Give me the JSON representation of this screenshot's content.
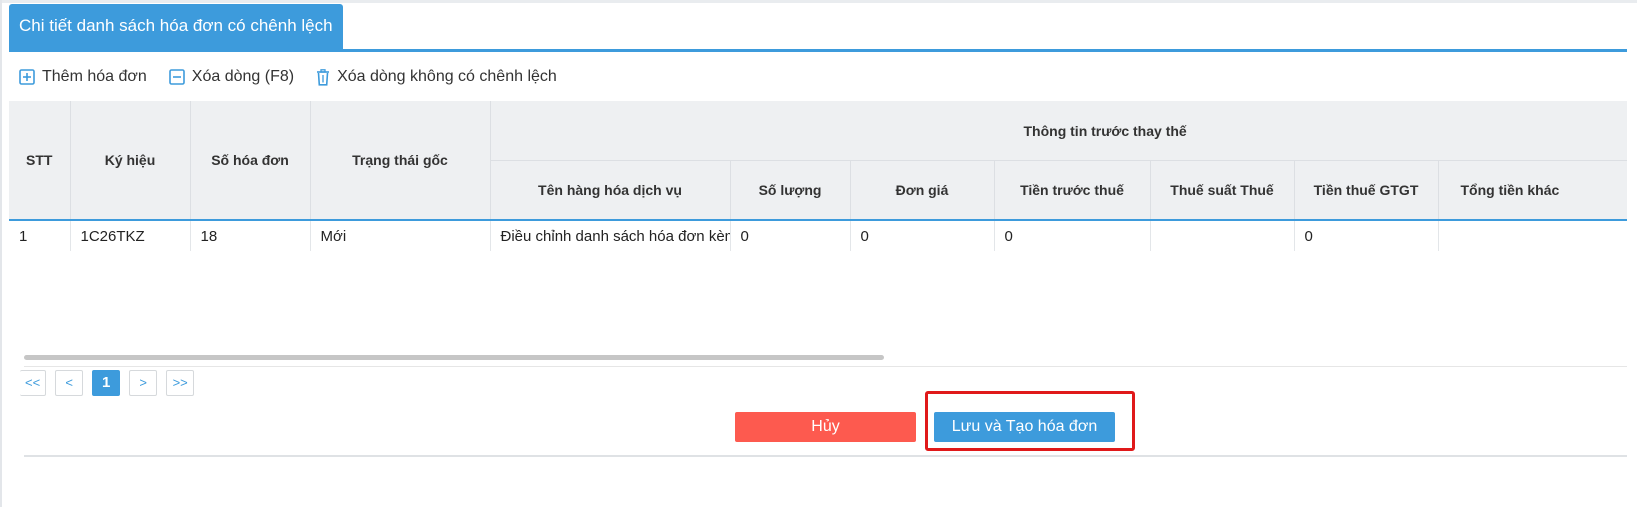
{
  "tab": {
    "title": "Chi tiết danh sách hóa đơn có chênh lệch"
  },
  "toolbar": {
    "add_label": "Thêm hóa đơn",
    "delete_label": "Xóa dòng (F8)",
    "delete_no_diff_label": "Xóa dòng không có chênh lệch"
  },
  "table": {
    "headers": {
      "stt": "STT",
      "ky_hieu": "Ký hiệu",
      "so_hoa_don": "Số hóa đơn",
      "trang_thai_goc": "Trạng thái gốc",
      "group_before": "Thông tin trước thay thế",
      "ten_hang": "Tên hàng hóa dịch vụ",
      "so_luong": "Số lượng",
      "don_gia": "Đơn giá",
      "tien_truoc_thue": "Tiền trước thuế",
      "thue_suat": "Thuế suất Thuế",
      "tien_thue": "Tiền thuế GTGT",
      "tong_tien_khac": "Tổng tiền khác"
    },
    "rows": [
      {
        "stt": "1",
        "ky_hieu": "1C26TKZ",
        "so_hoa_don": "18",
        "trang_thai_goc": "Mới",
        "ten_hang": "Điều chỉnh danh sách hóa đơn kèm",
        "so_luong": "0",
        "don_gia": "0",
        "tien_truoc_thue": "0",
        "thue_suat": "",
        "tien_thue": "0",
        "tong_tien_khac": ""
      }
    ]
  },
  "pager": {
    "first": "<<",
    "prev": "<",
    "current": "1",
    "next": ">",
    "last": ">>"
  },
  "actions": {
    "cancel_label": "Hủy",
    "save_label": "Lưu và Tạo hóa đơn"
  },
  "colors": {
    "accent": "#3d9bdc",
    "danger": "#fd5a4f",
    "highlight": "#e0191a"
  }
}
